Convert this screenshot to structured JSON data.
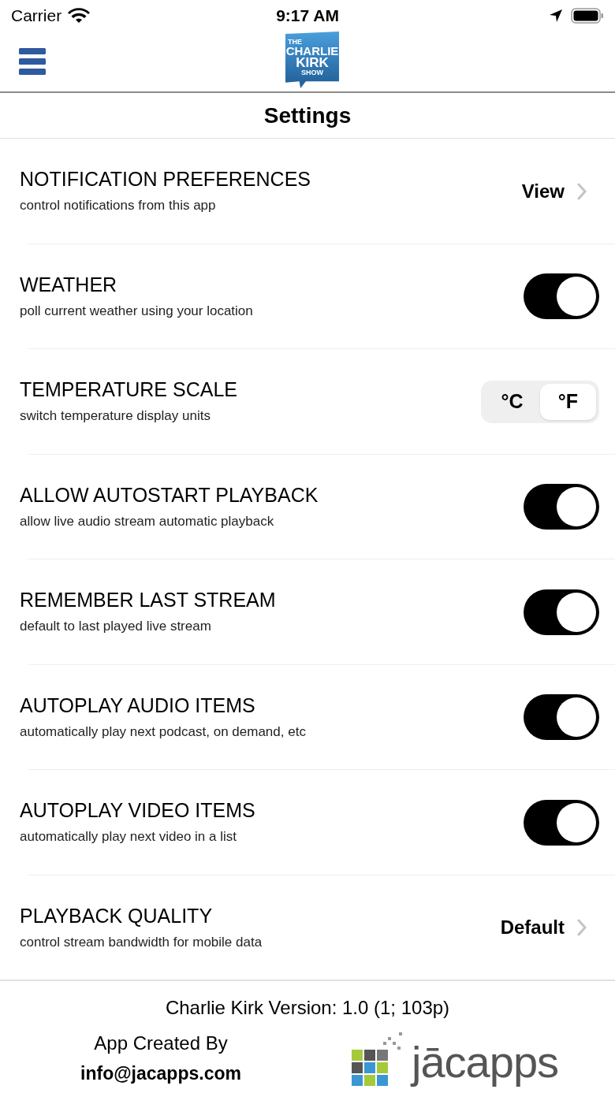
{
  "status_bar": {
    "carrier": "Carrier",
    "time": "9:17 AM"
  },
  "header": {
    "logo": [
      "THE",
      "CHARLIE",
      "KIRK",
      "SHOW"
    ]
  },
  "title": "Settings",
  "rows": [
    {
      "kind": "link",
      "title": "NOTIFICATION PREFERENCES",
      "subtitle": "control notifications from this app",
      "value": "View"
    },
    {
      "kind": "toggle",
      "title": "WEATHER",
      "subtitle": "poll current weather using your location",
      "on": true
    },
    {
      "kind": "segment",
      "title": "TEMPERATURE SCALE",
      "subtitle": "switch temperature display units",
      "options": [
        {
          "label": "°C",
          "selected": false
        },
        {
          "label": "°F",
          "selected": true
        }
      ]
    },
    {
      "kind": "toggle",
      "title": "ALLOW AUTOSTART PLAYBACK",
      "subtitle": "allow live audio stream automatic playback",
      "on": true
    },
    {
      "kind": "toggle",
      "title": "REMEMBER LAST STREAM",
      "subtitle": "default to last played live stream",
      "on": true
    },
    {
      "kind": "toggle",
      "title": "AUTOPLAY AUDIO ITEMS",
      "subtitle": "automatically play next podcast, on demand, etc",
      "on": true
    },
    {
      "kind": "toggle",
      "title": "AUTOPLAY VIDEO ITEMS",
      "subtitle": "automatically play next video in a list",
      "on": true
    },
    {
      "kind": "link",
      "title": "PLAYBACK QUALITY",
      "subtitle": "control stream bandwidth for mobile data",
      "value": "Default"
    }
  ],
  "footer": {
    "version": "Charlie Kirk Version: 1.0 (1; 103p)",
    "created_by": "App Created By",
    "email": "info@jacapps.com",
    "brand": "jācapps"
  }
}
